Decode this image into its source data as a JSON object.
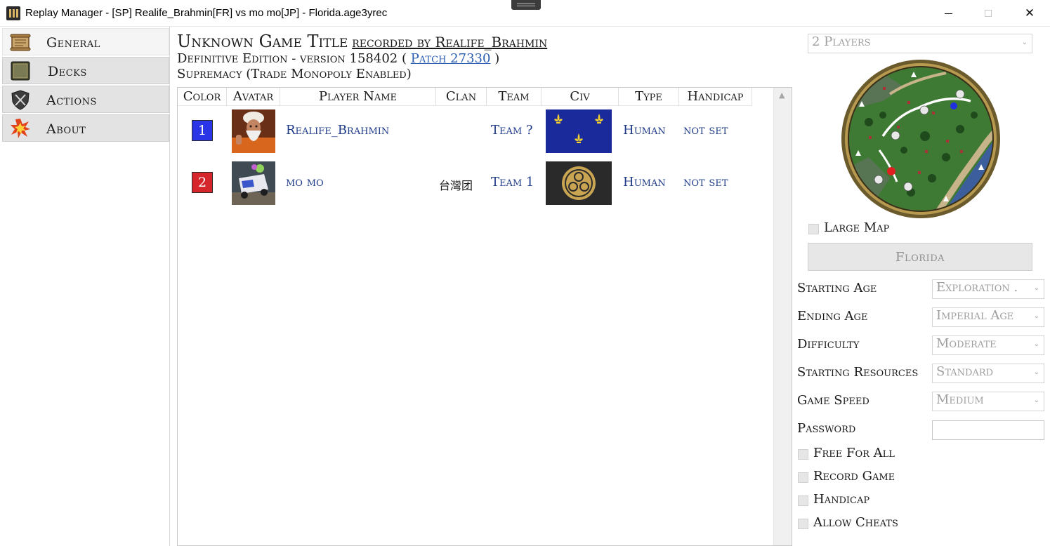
{
  "window": {
    "title": "Replay Manager - [SP] Realife_Brahmin[FR] vs mo mo[JP] - Florida.age3yrec",
    "minimize_glyph": "",
    "maximize_glyph": "",
    "close_glyph": "✕",
    "icon": "app-columns-icon"
  },
  "sidebar": {
    "items": [
      {
        "label": "General",
        "icon": "scroll-icon",
        "active": true
      },
      {
        "label": "Decks",
        "icon": "deck-card-icon",
        "active": false
      },
      {
        "label": "Actions",
        "icon": "crossed-swords-shield-icon",
        "active": false
      },
      {
        "label": "About",
        "icon": "explosion-icon",
        "active": false
      }
    ]
  },
  "header": {
    "game_title": "Unknown Game Title",
    "recorded_by": "recorded by Realife_Brahmin",
    "edition_prefix": "Definitive Edition - version 158402 (",
    "patch_link": "Patch 27330",
    "edition_suffix": ")",
    "mode": "Supremacy (Trade Monopoly Enabled)"
  },
  "table": {
    "columns": [
      "Color",
      "Avatar",
      "Player Name",
      "Clan",
      "Team",
      "Civ",
      "Type",
      "Handicap"
    ],
    "players": [
      {
        "color_number": "1",
        "color": "#2b35e8",
        "name": "Realife_Brahmin",
        "clan": "",
        "team": "Team ?",
        "civ_flag": "france-fleur-de-lis-flag",
        "type": "Human",
        "handicap": "not set"
      },
      {
        "color_number": "2",
        "color": "#d6262b",
        "name": "mo mo",
        "clan": "台灣团",
        "team": "Team 1",
        "civ_flag": "japan-mon-flag",
        "type": "Human",
        "handicap": "not set"
      }
    ],
    "scroll_up_glyph": "▲"
  },
  "right_panel": {
    "players_select": "2 Players",
    "large_map_label": "Large Map",
    "large_map_checked": false,
    "map_name": "Florida",
    "settings": [
      {
        "label": "Starting Age",
        "value": "Exploration ."
      },
      {
        "label": "Ending Age",
        "value": "Imperial Age"
      },
      {
        "label": "Difficulty",
        "value": "Moderate"
      },
      {
        "label": "Starting Resources",
        "value": "Standard"
      },
      {
        "label": "Game Speed",
        "value": "Medium"
      }
    ],
    "password_label": "Password",
    "password_value": "",
    "options": [
      {
        "label": "Free For All",
        "checked": false
      },
      {
        "label": "Record Game",
        "checked": false
      },
      {
        "label": "Handicap",
        "checked": false
      },
      {
        "label": "Allow Cheats",
        "checked": false
      }
    ],
    "chevron_glyph": "⌄"
  }
}
